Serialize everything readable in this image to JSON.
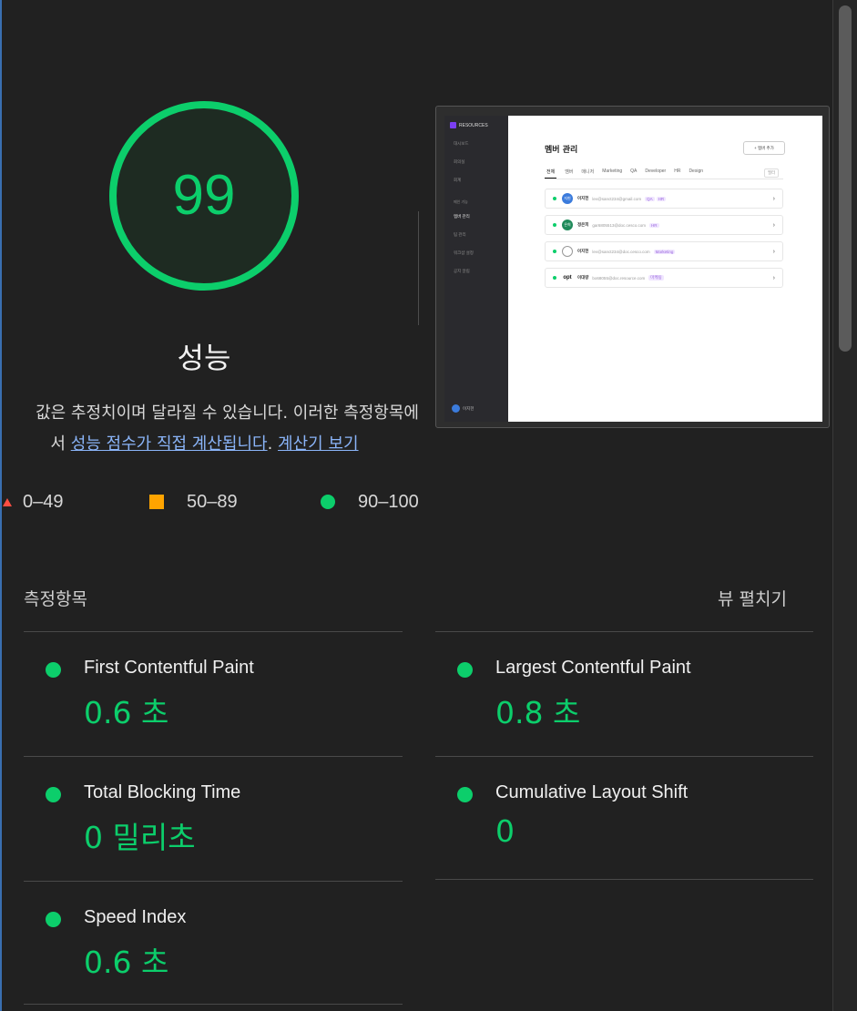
{
  "score": {
    "value": "99",
    "title": "성능",
    "color": "#0cce6b"
  },
  "description": {
    "line1": "값은 추정치이며 달라질 수 있습니다. 이러한 측정항목에",
    "line2_prefix": "서 ",
    "link_score": "성능 점수가 직접 계산됩니다",
    "line2_mid": ". ",
    "link_calculator": "계산기 보기"
  },
  "legend": {
    "fail_label": "0–49",
    "average_label": "50–89",
    "pass_label": "90–100",
    "colors": {
      "fail": "#ff4e42",
      "average": "#ffa400",
      "pass": "#0cce6b"
    }
  },
  "thumbnail": {
    "brand": "RESOURCES",
    "nav": [
      "대시보드",
      "회의실",
      "회계",
      "메인 기능",
      "멤버 관리",
      "팀 관리",
      "워크샵 설정",
      "공지 알림"
    ],
    "user": "이지헌",
    "page_title": "멤버 관리",
    "add_button": "+ 멤버 추가",
    "tabs": [
      "전체",
      "멤버",
      "매니저",
      "Marketing",
      "QA",
      "Developer",
      "HR",
      "Design"
    ],
    "filter": "필터",
    "rows": [
      {
        "avatar": "지헌",
        "name": "이지헌",
        "email": "lev@sanct234@gmail.com",
        "tags": [
          "QA",
          "HR"
        ]
      },
      {
        "avatar": "은희",
        "name": "정은희",
        "email": "gar6805513@doc.cesco.com",
        "tags": [
          "HR"
        ]
      },
      {
        "avatar": "",
        "name": "이지헌",
        "email": "lev@sanct234@doc.cesco.com",
        "tags": [
          "Marketing"
        ]
      },
      {
        "avatar": "opt",
        "name": "이대량",
        "email": "bo68055@doc.resource.com",
        "tags": [
          "마케팅"
        ]
      }
    ]
  },
  "metrics": {
    "title": "측정항목",
    "expand_label": "뷰 펼치기",
    "items": [
      {
        "name": "First Contentful Paint",
        "value": "0.6 초"
      },
      {
        "name": "Largest Contentful Paint",
        "value": "0.8 초"
      },
      {
        "name": "Total Blocking Time",
        "value": "0 밀리초"
      },
      {
        "name": "Cumulative Layout Shift",
        "value": "0"
      },
      {
        "name": "Speed Index",
        "value": "0.6 초"
      }
    ]
  }
}
